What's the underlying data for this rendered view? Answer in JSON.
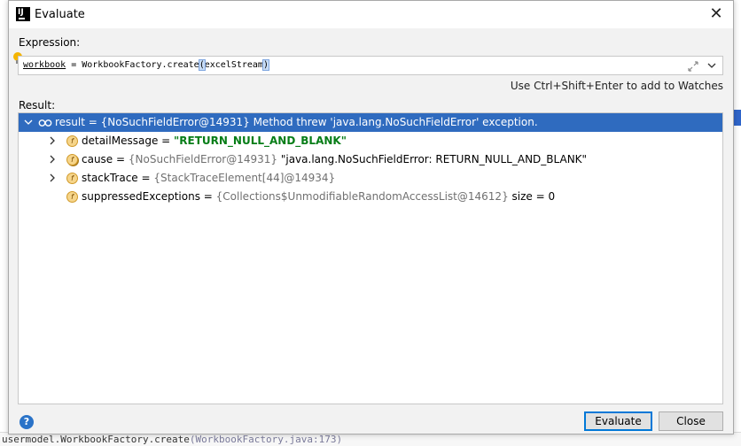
{
  "dialog": {
    "title": "Evaluate",
    "close_glyph": "✕"
  },
  "expression": {
    "label": "Expression:",
    "var": "workbook",
    "mid": " = WorkbookFactory.create",
    "paren_open": "(",
    "arg": "excelStream",
    "paren_close": ")",
    "hint": "Use Ctrl+Shift+Enter to add to Watches"
  },
  "result": {
    "label": "Result:",
    "root": "result = {NoSuchFieldError@14931} Method threw 'java.lang.NoSuchFieldError' exception.",
    "fields": [
      {
        "name": "detailMessage",
        "eq": " = ",
        "value": "\"RETURN_NULL_AND_BLANK\"",
        "badge": "f"
      },
      {
        "name": "cause",
        "eq": " = ",
        "ref": "{NoSuchFieldError@14931}",
        "value": " \"java.lang.NoSuchFieldError: RETURN_NULL_AND_BLANK\"",
        "badge": "f"
      },
      {
        "name": "stackTrace",
        "eq": " = ",
        "ref": "{StackTraceElement[44]@14934}",
        "badge": "f"
      },
      {
        "name": "suppressedExceptions",
        "eq": " = ",
        "ref": "{Collections$UnmodifiableRandomAccessList@14612}",
        "value": "  size = 0",
        "badge": "f"
      }
    ]
  },
  "buttons": {
    "evaluate": "Evaluate",
    "close": "Close",
    "help": "?"
  },
  "background": {
    "bottom_text": "usermodel.WorkbookFactory.create",
    "bottom_link": "(WorkbookFactory.java:173)"
  },
  "colors": {
    "selection": "#2f6bbf",
    "string_value": "#067d17",
    "reference": "#707070",
    "badge": "#f6d58a"
  },
  "icons": [
    "intellij-app-icon",
    "close-icon",
    "lightbulb-icon",
    "expand-icon",
    "chevron-down-icon",
    "infinity-icon",
    "field-icon",
    "help-icon"
  ]
}
